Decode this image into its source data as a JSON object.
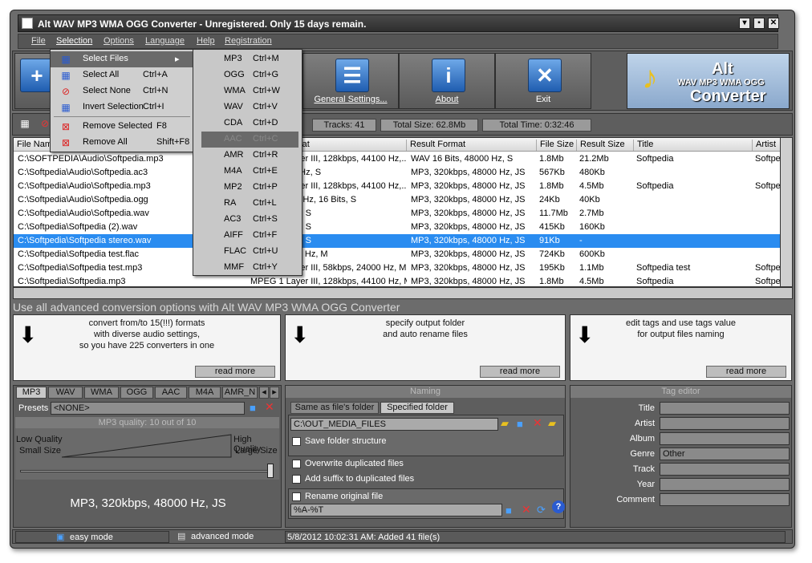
{
  "window": {
    "title": "Alt WAV MP3 WMA OGG Converter - Unregistered. Only 15 days remain."
  },
  "menubar": [
    "File",
    "Selection",
    "Options",
    "Language",
    "Help",
    "Registration"
  ],
  "toolbar": {
    "general_settings": "General Settings...",
    "about": "About",
    "exit": "Exit",
    "logo_line1": "Alt",
    "logo_line2": "WAV MP3 WMA OGG",
    "logo_line3": "Converter"
  },
  "stats": {
    "tracks": "Tracks: 41",
    "total_size": "Total Size: 62.8Mb",
    "total_time": "Total Time: 0:32:46"
  },
  "table": {
    "columns": [
      "File Name",
      "Source Format",
      "Result Format",
      "File Size",
      "Result Size",
      "Title",
      "Artist"
    ],
    "rows": [
      {
        "file": "C:\\SOFTPEDIA\\Audio\\Softpedia.mp3",
        "fmt": "MPEG 1 Layer III, 128kbps, 44100 Hz,...",
        "res": "WAV 16 Bits, 48000 Hz, S",
        "size": "1.8Mb",
        "rsize": "21.2Mb",
        "title": "Softpedia",
        "artist": "Softpedia"
      },
      {
        "file": "C:\\Softpedia\\Audio\\Softpedia.ac3",
        "fmt": "AC3, 48000 Hz, S",
        "res": "MP3, 320kbps, 48000 Hz, JS",
        "size": "567Kb",
        "rsize": "480Kb",
        "title": "",
        "artist": ""
      },
      {
        "file": "C:\\Softpedia\\Audio\\Softpedia.mp3",
        "fmt": "MPEG 1 Layer III, 128kbps, 44100 Hz,...",
        "res": "MP3, 320kbps, 48000 Hz, JS",
        "size": "1.8Mb",
        "rsize": "4.5Mb",
        "title": "Softpedia",
        "artist": "Softpedia"
      },
      {
        "file": "C:\\Softpedia\\Audio\\Softpedia.ogg",
        "fmt": "OGG, 44100 Hz, 16 Bits, S",
        "res": "MP3, 320kbps, 48000 Hz, JS",
        "size": "24Kb",
        "rsize": "40Kb",
        "title": "",
        "artist": ""
      },
      {
        "file": "C:\\Softpedia\\Audio\\Softpedia.wav",
        "fmt": "WAV, 16 Bits, S",
        "res": "MP3, 320kbps, 48000 Hz, JS",
        "size": "11.7Mb",
        "rsize": "2.7Mb",
        "title": "",
        "artist": ""
      },
      {
        "file": "C:\\Softpedia\\Softpedia (2).wav",
        "fmt": "WAV, 16 Bits, S",
        "res": "MP3, 320kbps, 48000 Hz, JS",
        "size": "415Kb",
        "rsize": "160Kb",
        "title": "",
        "artist": ""
      },
      {
        "file": "C:\\Softpedia\\Softpedia stereo.wav",
        "fmt": "WAV, 16 Bits, S",
        "res": "MP3, 320kbps, 48000 Hz, JS",
        "size": "91Kb",
        "rsize": "-",
        "title": "",
        "artist": ""
      },
      {
        "file": "C:\\Softpedia\\Softpedia test.flac",
        "fmt": "FLAC, 24000 Hz, M",
        "res": "MP3, 320kbps, 48000 Hz, JS",
        "size": "724Kb",
        "rsize": "600Kb",
        "title": "",
        "artist": ""
      },
      {
        "file": "C:\\Softpedia\\Softpedia test.mp3",
        "fmt": "MPEG 2 Layer III, 58kbps, 24000 Hz, M",
        "res": "MP3, 320kbps, 48000 Hz, JS",
        "size": "195Kb",
        "rsize": "1.1Mb",
        "title": "Softpedia test",
        "artist": "Softpedia"
      },
      {
        "file": "C:\\Softpedia\\Softpedia.mp3",
        "fmt": "MPEG 1 Layer III, 128kbps, 44100 Hz, M",
        "res": "MP3, 320kbps, 48000 Hz, JS",
        "size": "1.8Mb",
        "rsize": "4.5Mb",
        "title": "Softpedia",
        "artist": "Softpedia"
      }
    ],
    "selected_row": 6
  },
  "banner": "Use all advanced conversion options with Alt WAV MP3 WMA OGG Converter",
  "info_boxes": [
    {
      "text": "convert from/to 15(!!!) formats\nwith diverse audio settings,\nso you have 225 converters in one",
      "more": "read more"
    },
    {
      "text": "specify output folder\nand auto rename files",
      "more": "read more"
    },
    {
      "text": "edit tags and use tags value\nfor output files naming",
      "more": "read more"
    }
  ],
  "format_tabs": [
    "MP3",
    "WAV",
    "WMA",
    "OGG",
    "AAC",
    "M4A",
    "AMR_N"
  ],
  "presets": {
    "label": "Presets",
    "value": "<NONE>"
  },
  "quality": {
    "header": "MP3 quality: 10 out of 10",
    "low": "Low Quality",
    "small": "Small Size",
    "high": "High Quality",
    "large": "Large Size",
    "level": 1.0,
    "summary": "MP3, 320kbps, 48000 Hz, JS"
  },
  "naming": {
    "title": "Naming",
    "tab_same": "Same as file's folder",
    "tab_specified": "Specified folder",
    "folder": "C:\\OUT_MEDIA_FILES",
    "save_structure": "Save folder structure",
    "overwrite": "Overwrite duplicated files",
    "add_suffix": "Add suffix to duplicated files",
    "rename": "Rename original file",
    "pattern": "%A-%T"
  },
  "tag_editor": {
    "title": "Tag editor",
    "fields": [
      {
        "label": "Title",
        "value": ""
      },
      {
        "label": "Artist",
        "value": ""
      },
      {
        "label": "Album",
        "value": ""
      },
      {
        "label": "Genre",
        "value": "Other"
      },
      {
        "label": "Track",
        "value": ""
      },
      {
        "label": "Year",
        "value": ""
      },
      {
        "label": "Comment",
        "value": ""
      }
    ]
  },
  "status": {
    "easy": "easy mode",
    "advanced": "advanced mode",
    "log": "5/8/2012 10:02:31 AM: Added 41 file(s)"
  },
  "selection_menu": [
    {
      "label": "Select Files",
      "shortcut": ""
    },
    {
      "label": "Select All",
      "shortcut": "Ctrl+A"
    },
    {
      "label": "Select None",
      "shortcut": "Ctrl+N"
    },
    {
      "label": "Invert Selection",
      "shortcut": "Ctrl+I"
    },
    {
      "label": "Remove Selected",
      "shortcut": "F8"
    },
    {
      "label": "Remove All",
      "shortcut": "Shift+F8"
    }
  ],
  "submenu": [
    {
      "label": "MP3",
      "shortcut": "Ctrl+M"
    },
    {
      "label": "OGG",
      "shortcut": "Ctrl+G"
    },
    {
      "label": "WMA",
      "shortcut": "Ctrl+W"
    },
    {
      "label": "WAV",
      "shortcut": "Ctrl+V"
    },
    {
      "label": "CDA",
      "shortcut": "Ctrl+D"
    },
    {
      "label": "AAC",
      "shortcut": "Ctrl+C"
    },
    {
      "label": "AMR",
      "shortcut": "Ctrl+R"
    },
    {
      "label": "M4A",
      "shortcut": "Ctrl+E"
    },
    {
      "label": "MP2",
      "shortcut": "Ctrl+P"
    },
    {
      "label": "RA",
      "shortcut": "Ctrl+L"
    },
    {
      "label": "AC3",
      "shortcut": "Ctrl+S"
    },
    {
      "label": "AIFF",
      "shortcut": "Ctrl+F"
    },
    {
      "label": "FLAC",
      "shortcut": "Ctrl+U"
    },
    {
      "label": "MMF",
      "shortcut": "Ctrl+Y"
    }
  ],
  "colors": {
    "selection": "#2a8cf0",
    "panel": "#5e5e5e",
    "menu_highlight": "#6a6a6a"
  }
}
